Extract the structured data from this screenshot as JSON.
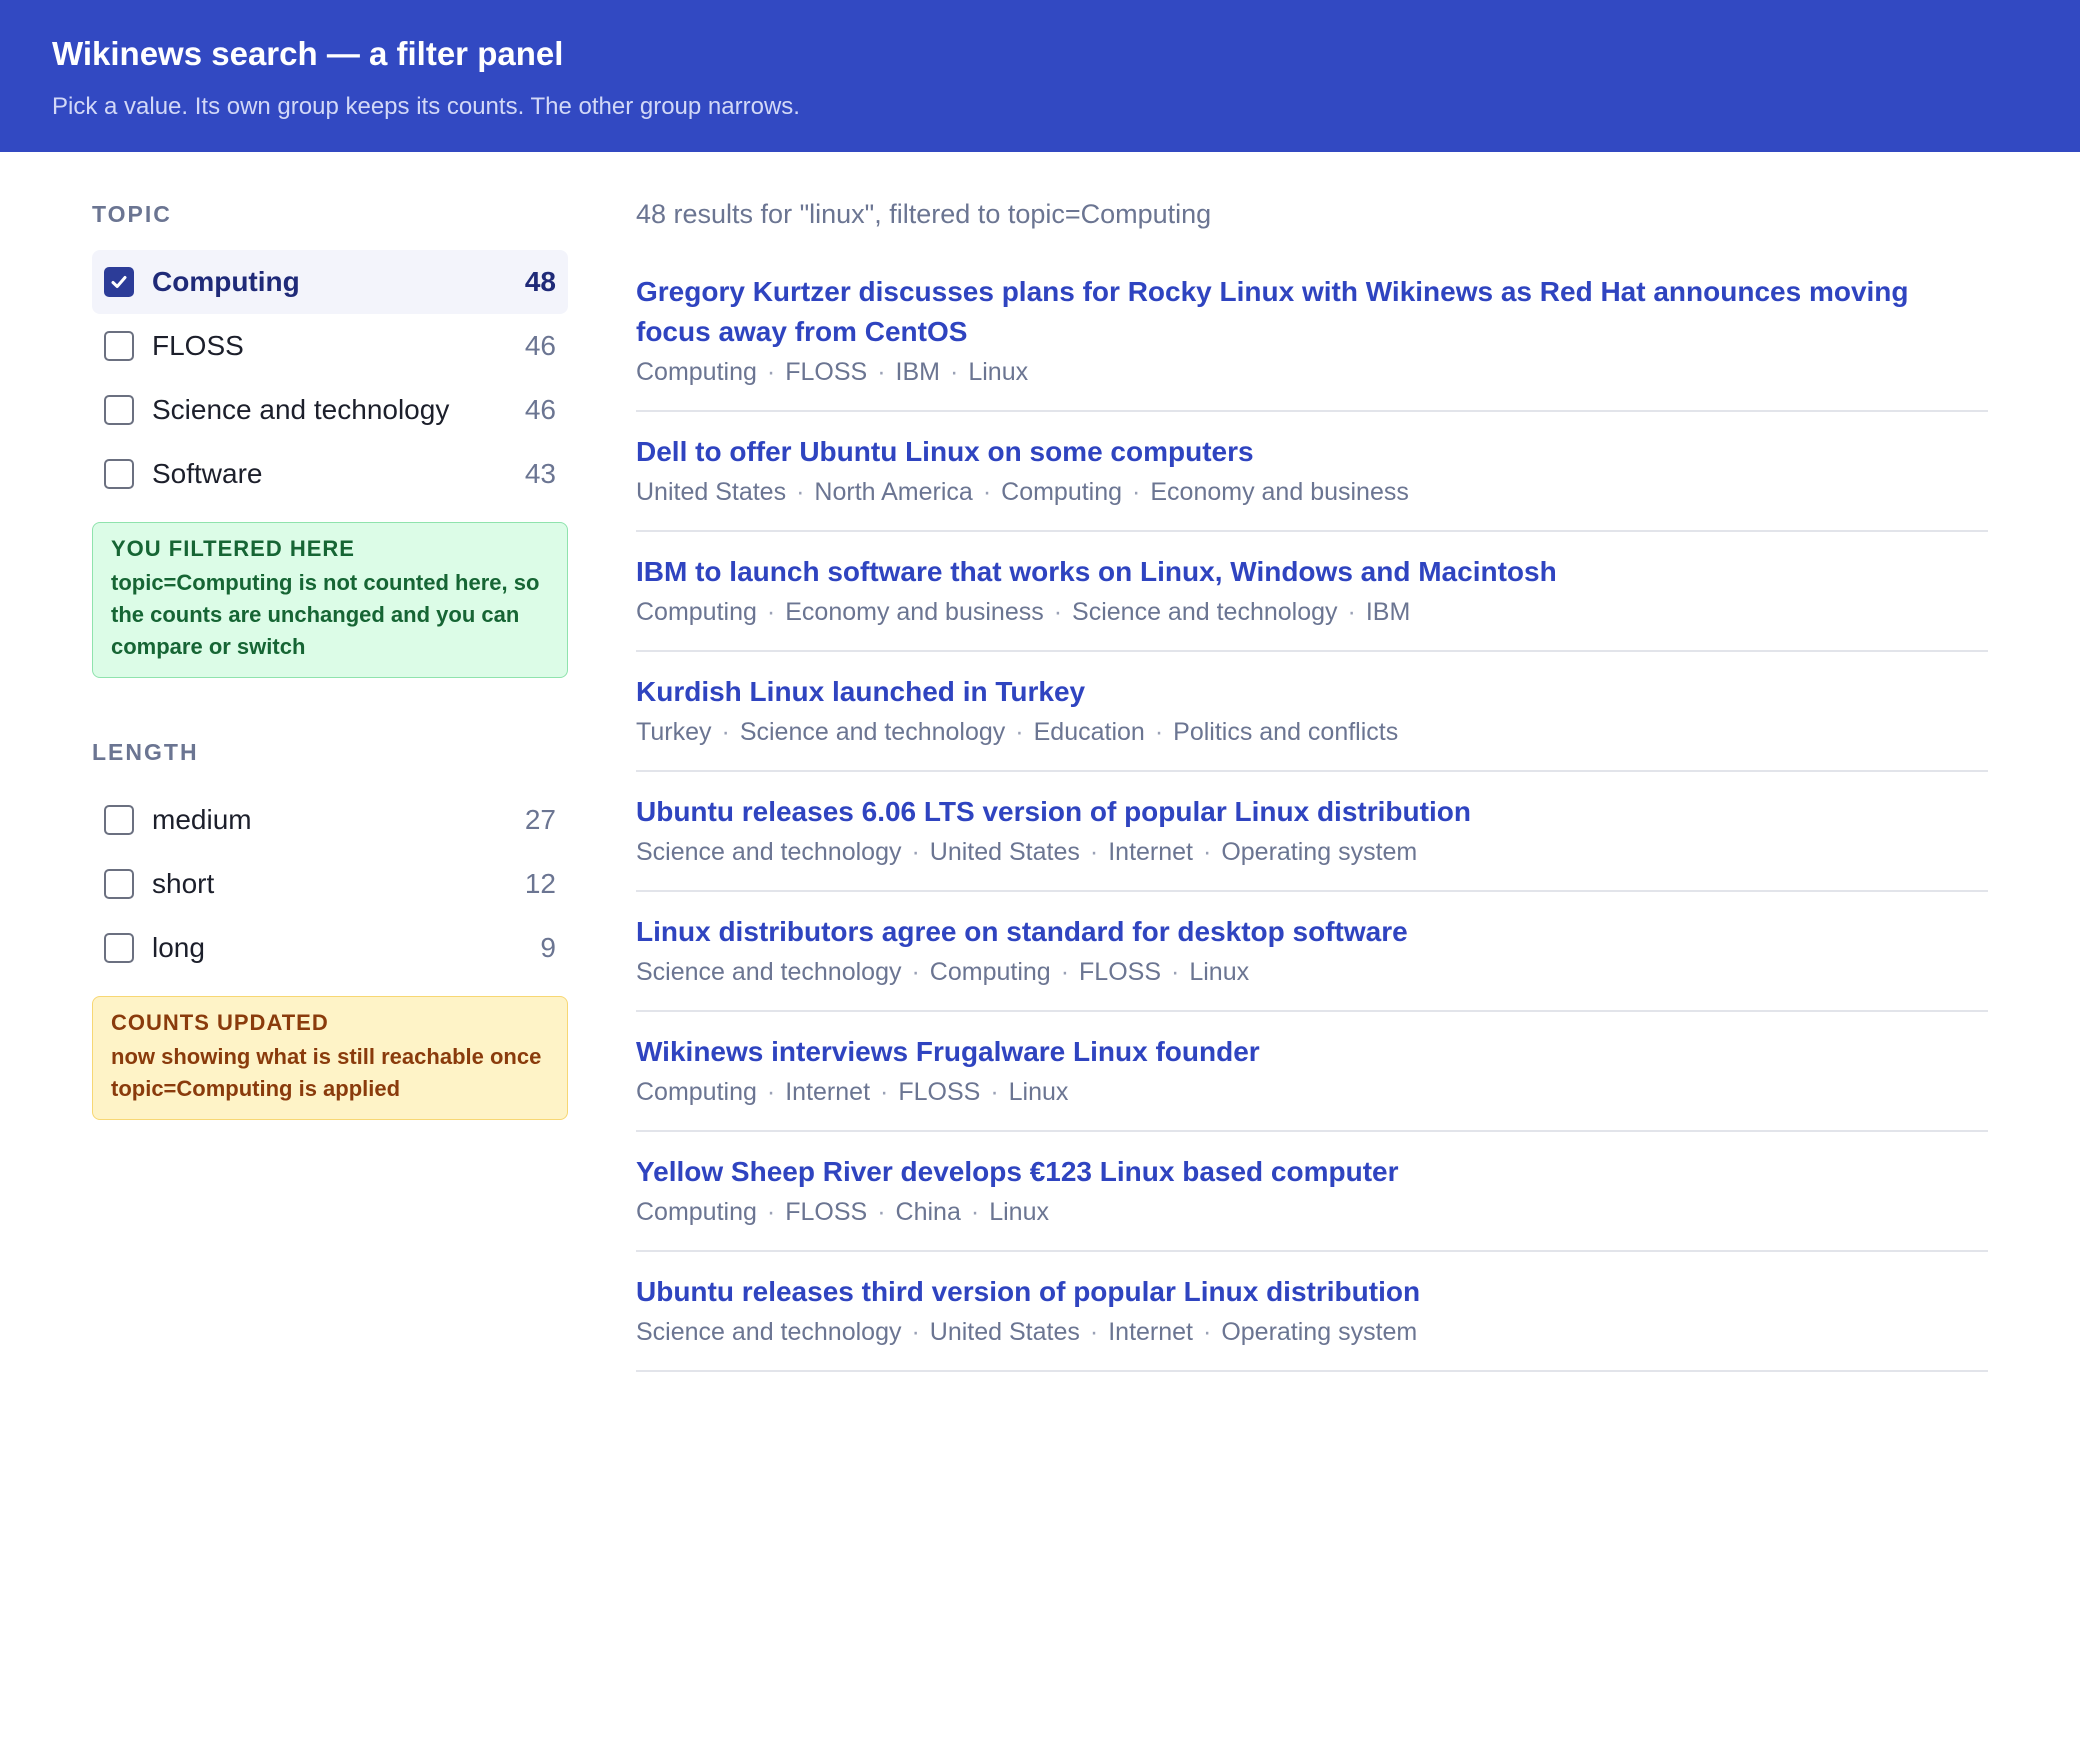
{
  "header": {
    "title": "Wikinews search — a filter panel",
    "subtitle": "Pick a value. Its own group keeps its counts. The other group narrows."
  },
  "sidebar": {
    "topic": {
      "title": "TOPIC",
      "items": [
        {
          "label": "Computing",
          "count": "48",
          "checked": true
        },
        {
          "label": "FLOSS",
          "count": "46",
          "checked": false
        },
        {
          "label": "Science and technology",
          "count": "46",
          "checked": false
        },
        {
          "label": "Software",
          "count": "43",
          "checked": false
        }
      ],
      "note": {
        "title": "YOU FILTERED HERE",
        "body": "topic=Computing is not counted here, so the counts are unchanged and you can compare or switch"
      }
    },
    "length": {
      "title": "LENGTH",
      "items": [
        {
          "label": "medium",
          "count": "27",
          "checked": false
        },
        {
          "label": "short",
          "count": "12",
          "checked": false
        },
        {
          "label": "long",
          "count": "9",
          "checked": false
        }
      ],
      "note": {
        "title": "COUNTS UPDATED",
        "body": "now showing what is still reachable once topic=Computing is applied"
      }
    }
  },
  "main": {
    "summary": "48 results for \"linux\", filtered to topic=Computing",
    "results": [
      {
        "title": "Gregory Kurtzer discusses plans for Rocky Linux with Wikinews as Red Hat announces moving focus away from CentOS",
        "tags": [
          "Computing",
          "FLOSS",
          "IBM",
          "Linux"
        ]
      },
      {
        "title": "Dell to offer Ubuntu Linux on some computers",
        "tags": [
          "United States",
          "North America",
          "Computing",
          "Economy and business"
        ]
      },
      {
        "title": "IBM to launch software that works on Linux, Windows and Macintosh",
        "tags": [
          "Computing",
          "Economy and business",
          "Science and technology",
          "IBM"
        ]
      },
      {
        "title": "Kurdish Linux launched in Turkey",
        "tags": [
          "Turkey",
          "Science and technology",
          "Education",
          "Politics and conflicts"
        ]
      },
      {
        "title": "Ubuntu releases 6.06 LTS version of popular Linux distribution",
        "tags": [
          "Science and technology",
          "United States",
          "Internet",
          "Operating system"
        ]
      },
      {
        "title": "Linux distributors agree on standard for desktop software",
        "tags": [
          "Science and technology",
          "Computing",
          "FLOSS",
          "Linux"
        ]
      },
      {
        "title": "Wikinews interviews Frugalware Linux founder",
        "tags": [
          "Computing",
          "Internet",
          "FLOSS",
          "Linux"
        ]
      },
      {
        "title": "Yellow Sheep River develops €123 Linux based computer",
        "tags": [
          "Computing",
          "FLOSS",
          "China",
          "Linux"
        ]
      },
      {
        "title": "Ubuntu releases third version of popular Linux distribution",
        "tags": [
          "Science and technology",
          "United States",
          "Internet",
          "Operating system"
        ]
      }
    ]
  },
  "colors": {
    "header_bg": "#3249c2",
    "link": "#2f44c0",
    "checked": "#2c3c98",
    "note_green_bg": "#dcfce7",
    "note_yellow_bg": "#fef3c7"
  }
}
